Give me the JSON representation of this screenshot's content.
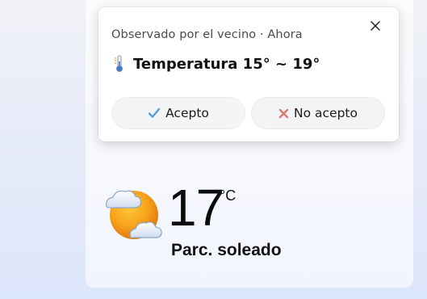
{
  "popup": {
    "subtitle": "Observado por el vecino · Ahora",
    "title": "Temperatura 15° ~ 19°",
    "title_icon": "thermometer-icon",
    "close_icon": "close-icon",
    "accept_label": "Acepto",
    "accept_icon": "checkmark-icon",
    "reject_label": "No acepto",
    "reject_icon": "x-mark-icon"
  },
  "weather": {
    "temperature": "17",
    "unit": "°C",
    "condition": "Parc. soleado",
    "icon": "partly-sunny-icon"
  },
  "colors": {
    "accent_check": "#5b9bd5",
    "reject_x": "#d97a72",
    "sun": "#f4a21b"
  }
}
